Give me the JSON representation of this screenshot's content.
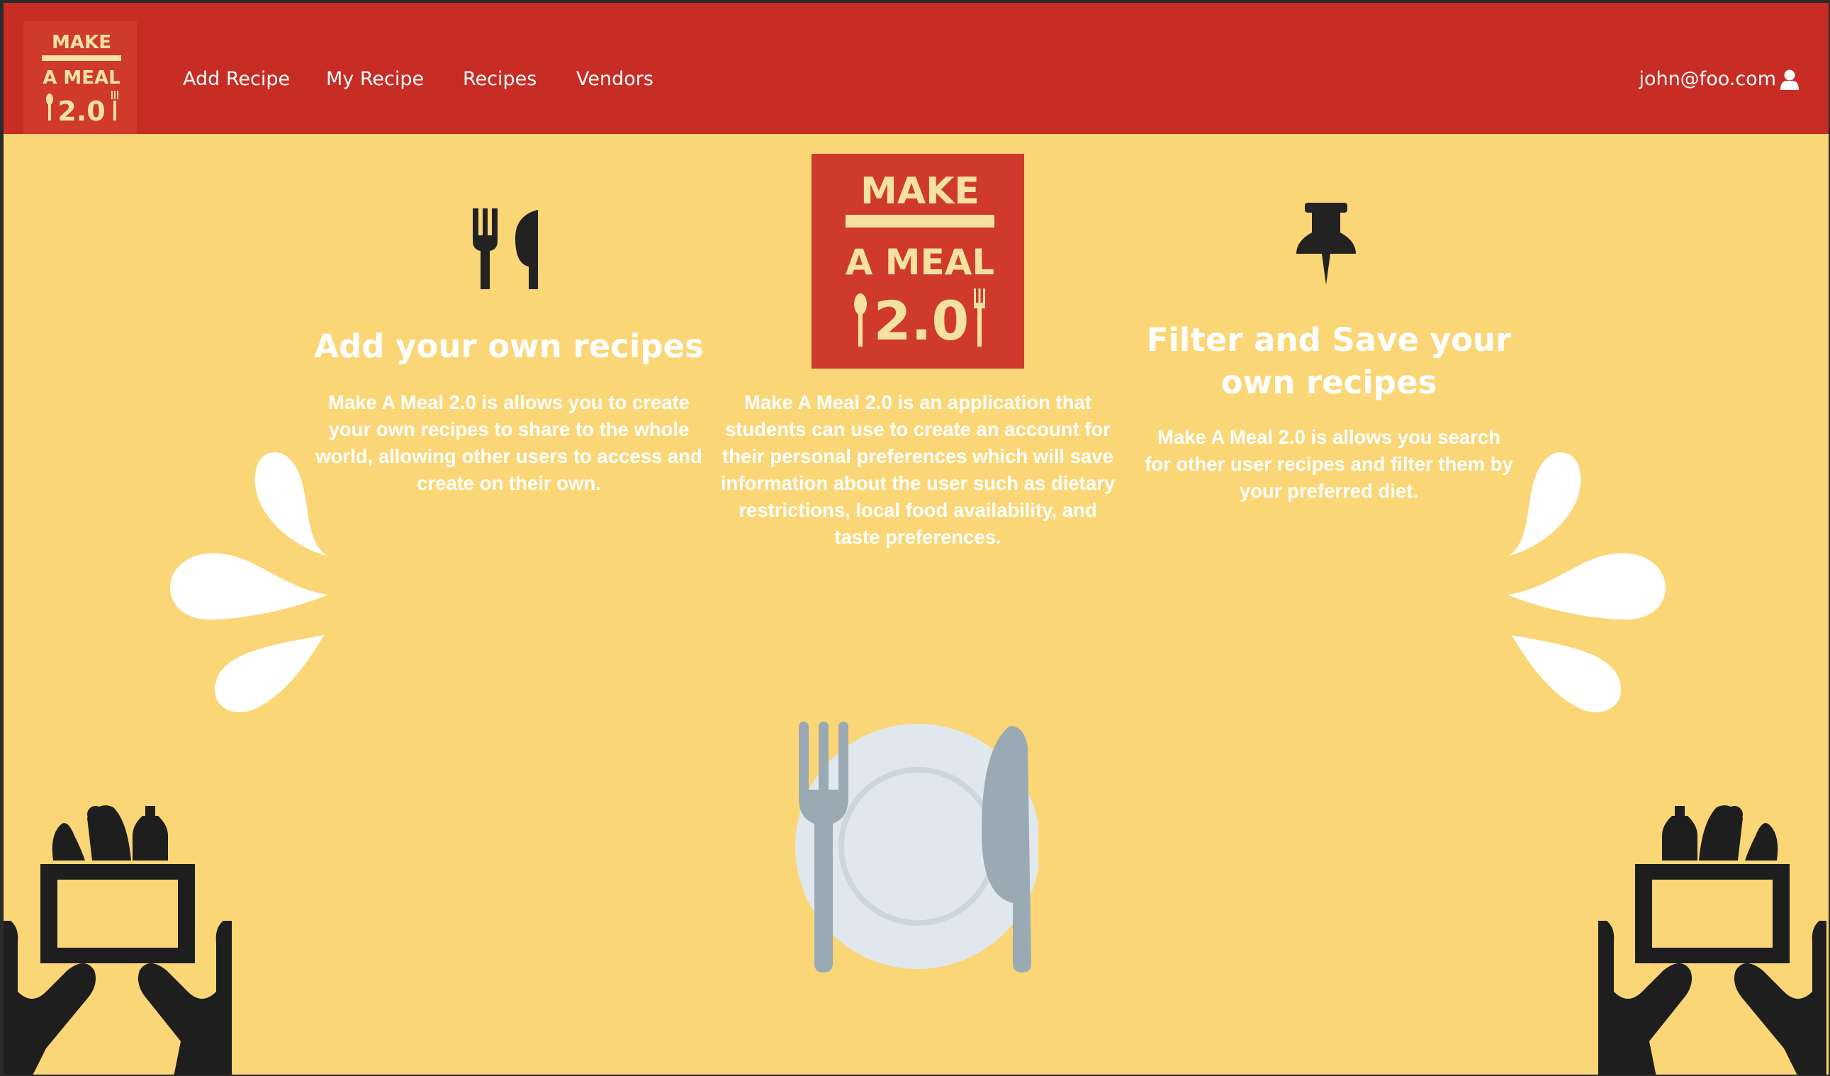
{
  "navbar": {
    "logo_text": "MAKE A MEAL 2.0",
    "links": [
      "Add Recipe",
      "My Recipe",
      "Recipes",
      "Vendors"
    ],
    "user_email": "john@foo.com"
  },
  "center_logo": {
    "text": "MAKE A MEAL 2.0"
  },
  "features": [
    {
      "icon": "utensils-icon",
      "title": "Add your own recipes",
      "text": "Make A Meal 2.0 is allows you to create your own recipes to share to the whole world, allowing other users to access and create on their own."
    },
    {
      "icon": "logo",
      "title": "",
      "text": "Make A Meal 2.0 is an application that students can use to create an account for their personal preferences which will save information about the user such as dietary restrictions, local food availability, and taste preferences."
    },
    {
      "icon": "thumbtack-icon",
      "title": "Filter and Save your own recipes",
      "text": "Make A Meal 2.0 is allows you search for other user recipes and filter them by your preferred diet."
    }
  ],
  "decorations": [
    "splash-left-icon",
    "splash-right-icon",
    "plate-cutlery-icon",
    "hands-food-box-left-icon",
    "hands-food-box-right-icon"
  ],
  "colors": {
    "navbar": "#c82d25",
    "background": "#fad677",
    "logo_red": "#cf3a2c",
    "logo_cream": "#f6e2a0",
    "text": "#ffffff"
  }
}
